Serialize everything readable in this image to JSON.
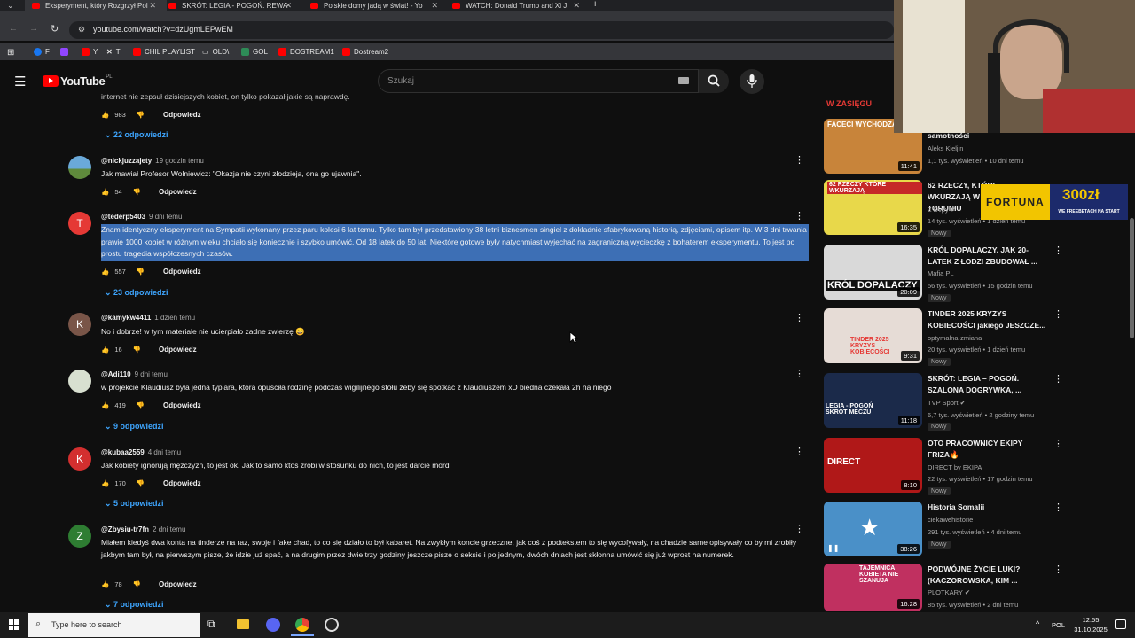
{
  "tabs": [
    {
      "label": "Eksperyment, który Rozgrzył Pol",
      "active": true
    },
    {
      "label": "SKRÓT: LEGIA - POGOŃ. REWA",
      "active": false
    },
    {
      "label": "Polskie domy jadą w świat! - Yo",
      "active": false
    },
    {
      "label": "WATCH: Donald Trump and Xi J",
      "active": false
    }
  ],
  "address": {
    "url": "youtube.com/watch?v=dzUgmLEPwEM"
  },
  "bookmarks": [
    "F",
    "Y",
    "T",
    "CHIL PLAYLIST",
    "OLD\\",
    "GOL",
    "DOSTREAM1",
    "Dostream2"
  ],
  "header": {
    "logo": "YouTube",
    "region": "PL",
    "search_placeholder": "Szukaj"
  },
  "top_fragment": {
    "text": "internet nie zepsuł dzisiejszych kobiet, on tylko pokazał jakie są naprawdę.",
    "likes": "983",
    "reply": "Odpowiedz",
    "replies": "22 odpowiedzi"
  },
  "comments": [
    {
      "handle": "@nickjuzzajety",
      "time": "19 godzin temu",
      "text": "Jak mawiał Profesor Wolniewicz: \"Okazja nie czyni złodzieja, ona go ujawnia\".",
      "likes": "54",
      "reply": "Odpowiedz",
      "replies": "",
      "avatar": "",
      "avatar_color": "#5a8fb0"
    },
    {
      "handle": "@tederp5403",
      "time": "9 dni temu",
      "text": "Znam identyczny eksperyment na Sympatii wykonany przez paru kolesi 6 lat temu. Tylko tam był przedstawiony 38 letni biznesmen singiel z dokładnie sfabrykowaną historią, zdjęciami, opisem itp. W 3 dni trwania prawie 1000 kobiet w różnym wieku chciało się koniecznie i szybko umówić. Od 18 latek do 50 lat. Niektóre gotowe były natychmiast wyjechać na zagraniczną wycieczkę z bohaterem eksperymentu. To jest po prostu tragedia współczesnych czasów.",
      "likes": "557",
      "reply": "Odpowiedz",
      "replies": "23 odpowiedzi",
      "avatar": "T",
      "avatar_color": "#e53935"
    },
    {
      "handle": "@kamykw4411",
      "time": "1 dzień temu",
      "text": "No i dobrze! w tym materiale nie ucierpiało żadne zwierzę 😄",
      "likes": "16",
      "reply": "Odpowiedz",
      "replies": "",
      "avatar": "K",
      "avatar_color": "#795548"
    },
    {
      "handle": "@Adi110",
      "time": "9 dni temu",
      "text": "w projekcie Klaudiusz była jedna typiara, która opuściła rodzinę podczas wigilijnego stołu żeby się spotkać z Klaudiuszem xD biedna czekała 2h na niego",
      "likes": "419",
      "reply": "Odpowiedz",
      "replies": "9 odpowiedzi",
      "avatar": "",
      "avatar_color": "#cfd8c8"
    },
    {
      "handle": "@kubaa2559",
      "time": "4 dni temu",
      "text": "Jak kobiety ignorują mężczyzn, to jest ok. Jak to samo ktoś zrobi w stosunku do nich, to jest darcie mord",
      "likes": "170",
      "reply": "Odpowiedz",
      "replies": "5 odpowiedzi",
      "avatar": "K",
      "avatar_color": "#d32f2f"
    },
    {
      "handle": "@Zbysiu-tr7fn",
      "time": "2 dni temu",
      "text": "Miałem kiedyś dwa konta na tinderze na raz, swoje i fake chad, to co się działo to był kabaret. Na zwykłym koncie grzeczne, jak coś z podtekstem to się wycofywały, na chadzie same opisywały co by mi zrobiły jakbym tam był, na pierwszym pisze, że idzie już spać, a na drugim przez dwie trzy godziny jeszcze pisze o seksie i po jednym, dwóch dniach jest skłonna umówić się już wprost na numerek.",
      "likes": "78",
      "reply": "Odpowiedz",
      "replies": "7 odpowiedzi",
      "avatar": "Z",
      "avatar_color": "#2e7d32"
    }
  ],
  "sidebar": {
    "partial_banner": "W ZASIĘGU",
    "videos": [
      {
        "title": "samotności",
        "thumb_text": "FACECI WYCHODZĄ",
        "channel": "Aleks Kieljin",
        "meta": "1,1 tys. wyświetleń • 10 dni temu",
        "duration": "11:41",
        "new": "",
        "verified": false,
        "thumb_color": "#c8843a"
      },
      {
        "title": "62 RZECZY, KTÓRE WKURZAJĄ W TORUNIU",
        "thumb_text": "62 RZECZY KTÓRE WKURZAJĄ",
        "channel": "Z Dvpy",
        "meta": "14 tys. wyświetleń • 1 dzień temu",
        "duration": "16:35",
        "new": "Nowy",
        "verified": true,
        "thumb_color": "#e8d84a"
      },
      {
        "title": "KRÓL DOPALACZY. JAK 20-LATEK Z ŁODZI ZBUDOWAŁ ...",
        "thumb_text": "KRÓL DOPALACZY",
        "channel": "Mafia PL",
        "meta": "56 tys. wyświetleń • 15 godzin temu",
        "duration": "20:09",
        "new": "Nowy",
        "verified": false,
        "thumb_color": "#d9d9d9"
      },
      {
        "title": "TINDER 2025 KRYZYS KOBIECOŚCI jakiego JESZCZE...",
        "thumb_text": "TINDER 2025 KRYZYS KOBIECOŚCI",
        "channel": "optymalna-zmiana",
        "meta": "20 tys. wyświetleń • 1 dzień temu",
        "duration": "9:31",
        "new": "Nowy",
        "verified": false,
        "thumb_color": "#e6dcd6"
      },
      {
        "title": "SKRÓT: LEGIA – POGOŃ. SZALONA DOGRYWKA, ...",
        "thumb_text": "LEGIA - POGOŃ SKRÓT MECZU",
        "channel": "TVP Sport",
        "meta": "6,7 tys. wyświetleń • 2 godziny temu",
        "duration": "11:18",
        "new": "Nowy",
        "verified": true,
        "thumb_color": "#1b2a4a"
      },
      {
        "title": "OTO PRACOWNICY EKIPY FRIZA🔥",
        "thumb_text": "DIRECT",
        "channel": "DIRECT by EKIPA",
        "meta": "22 tys. wyświetleń • 17 godzin temu",
        "duration": "8:10",
        "new": "Nowy",
        "verified": false,
        "thumb_color": "#b01818"
      },
      {
        "title": "Historia Somalii",
        "thumb_text": "",
        "channel": "ciekawehistorie",
        "meta": "291 tys. wyświetleń • 4 dni temu",
        "duration": "38:26",
        "new": "Nowy",
        "verified": false,
        "thumb_color": "#4a90c8"
      },
      {
        "title": "PODWÓJNE ŻYCIE LUKI? (KACZOROWSKA, KIM ...",
        "thumb_text": "TAJEMNICA KOBIETA NIE SZANUJA",
        "channel": "PLOTKARY",
        "meta": "85 tys. wyświetleń • 2 dni temu",
        "duration": "16:28",
        "new": "",
        "verified": true,
        "thumb_color": "#c03060"
      }
    ]
  },
  "overlay": {
    "sponsor": "FORTUNA",
    "sponsor_amount": "300zł",
    "sponsor_sub": "WE FREEBETACH NA START"
  },
  "taskbar": {
    "search_placeholder": "Type here to search",
    "lang": "POL",
    "time": "12:55",
    "date": "31.10.2025"
  }
}
